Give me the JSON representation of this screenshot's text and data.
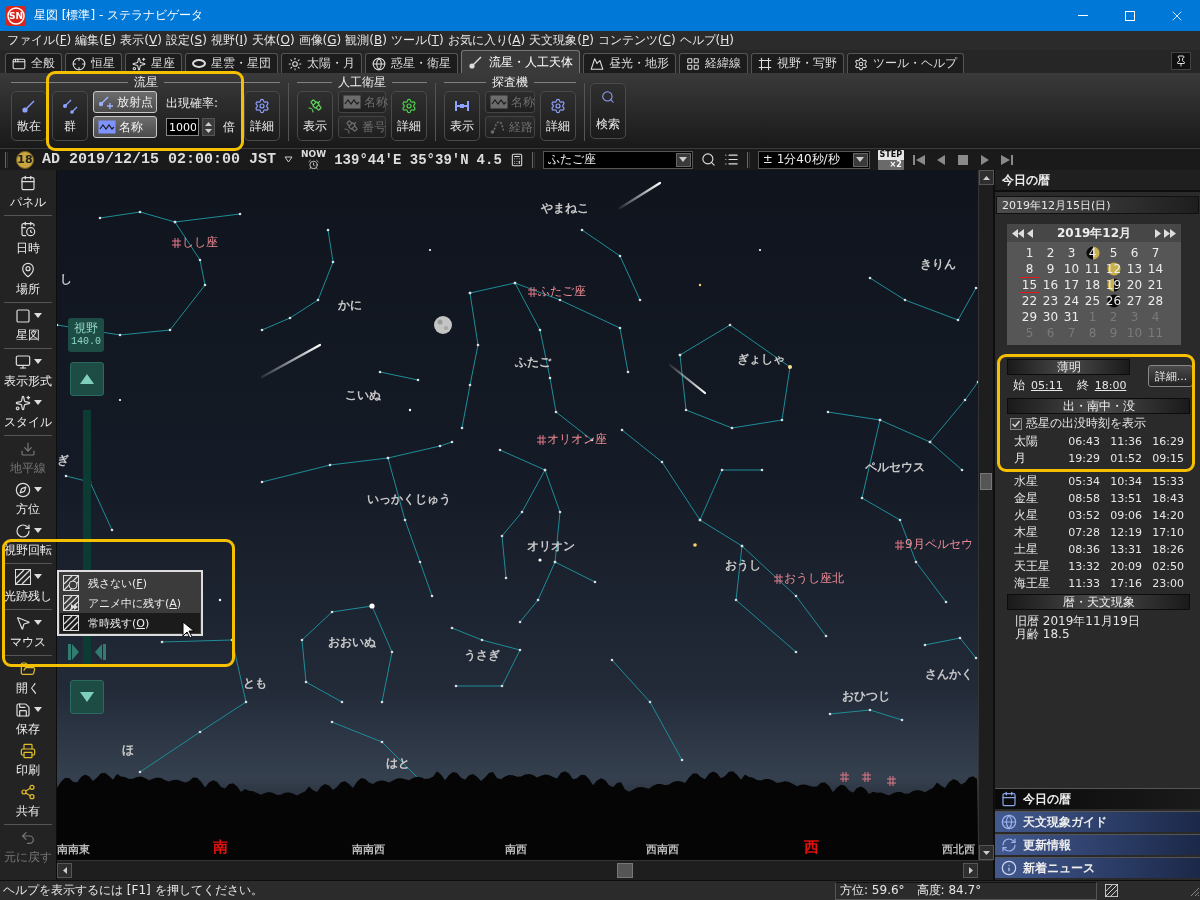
{
  "window": {
    "title": "星図 [標準] - ステラナビゲータ",
    "logo_text": "SN"
  },
  "menu": [
    "ファイル(F)",
    "編集(E)",
    "表示(V)",
    "設定(S)",
    "視野(I)",
    "天体(O)",
    "画像(G)",
    "観測(B)",
    "ツール(T)",
    "お気に入り(A)",
    "天文現象(P)",
    "コンテンツ(C)",
    "ヘルプ(H)"
  ],
  "tabs": [
    {
      "label": "全般",
      "selected": false
    },
    {
      "label": "恒星",
      "selected": false
    },
    {
      "label": "星座",
      "selected": false
    },
    {
      "label": "星雲・星団",
      "selected": false
    },
    {
      "label": "太陽・月",
      "selected": false
    },
    {
      "label": "惑星・衛星",
      "selected": false
    },
    {
      "label": "流星・人工天体",
      "selected": true
    },
    {
      "label": "昼光・地形",
      "selected": false
    },
    {
      "label": "経緯線",
      "selected": false
    },
    {
      "label": "視野・写野",
      "selected": false
    },
    {
      "label": "ツール・ヘルプ",
      "selected": false
    }
  ],
  "ribbon": {
    "groups": [
      {
        "title": "流星",
        "items": [
          {
            "kind": "large",
            "label": "散在",
            "disabled": false
          },
          {
            "kind": "large",
            "label": "群",
            "disabled": false
          },
          {
            "kind": "stack",
            "buttons": [
              {
                "label": "放射点",
                "checked": true,
                "disabled": false
              },
              {
                "label": "名称",
                "checked": true,
                "disabled": false
              }
            ]
          },
          {
            "kind": "spinner",
            "label": "出現確率:",
            "value": "1000",
            "unit": "倍"
          },
          {
            "kind": "large",
            "label": "詳細",
            "disabled": false
          }
        ]
      },
      {
        "title": "人工衛星",
        "items": [
          {
            "kind": "large",
            "label": "表示",
            "disabled": false
          },
          {
            "kind": "stack",
            "buttons": [
              {
                "label": "名称",
                "checked": false,
                "disabled": true
              },
              {
                "label": "番号",
                "checked": false,
                "disabled": true
              }
            ]
          },
          {
            "kind": "large",
            "label": "詳細",
            "disabled": false
          }
        ]
      },
      {
        "title": "探査機",
        "items": [
          {
            "kind": "large",
            "label": "表示",
            "disabled": false
          },
          {
            "kind": "stack",
            "buttons": [
              {
                "label": "名称",
                "checked": false,
                "disabled": true
              },
              {
                "label": "経路",
                "checked": false,
                "disabled": true
              }
            ]
          },
          {
            "kind": "large",
            "label": "詳細",
            "disabled": false
          }
        ]
      }
    ],
    "search": {
      "label": "検索"
    }
  },
  "info_bar": {
    "badge": "18",
    "datetime": "AD 2019/12/15 02:00:00 JST",
    "now_label": "NOW",
    "location": "139°44'E 35°39'N",
    "magnitude": "4.5",
    "target": "ふたご座",
    "speed": "± 1分40秒/秒",
    "step_label": "STEP",
    "step_factor": "×2"
  },
  "sidebar": {
    "groups": [
      {
        "items": [
          {
            "label": "パネル",
            "menu": false,
            "disabled": false
          }
        ]
      },
      {
        "items": [
          {
            "label": "日時",
            "menu": false,
            "disabled": false
          },
          {
            "label": "場所",
            "menu": false,
            "disabled": false
          }
        ]
      },
      {
        "items": [
          {
            "label": "星図",
            "menu": true,
            "disabled": false
          }
        ]
      },
      {
        "items": [
          {
            "label": "表示形式",
            "menu": true,
            "disabled": false
          },
          {
            "label": "スタイル",
            "menu": true,
            "disabled": false
          }
        ]
      },
      {
        "items": [
          {
            "label": "地平線",
            "menu": false,
            "disabled": true
          },
          {
            "label": "方位",
            "menu": true,
            "disabled": false
          },
          {
            "label": "視野回転",
            "menu": true,
            "disabled": false
          }
        ]
      },
      {
        "items": [
          {
            "label": "光跡残し",
            "menu": true,
            "disabled": false
          }
        ]
      },
      {
        "items": [
          {
            "label": "マウス",
            "menu": true,
            "disabled": false
          }
        ]
      },
      {
        "items": [
          {
            "label": "開く",
            "menu": false,
            "disabled": false
          },
          {
            "label": "保存",
            "menu": true,
            "disabled": false
          },
          {
            "label": "印刷",
            "menu": false,
            "disabled": false
          },
          {
            "label": "共有",
            "menu": false,
            "disabled": false
          }
        ]
      },
      {
        "items": [
          {
            "label": "元に戻す",
            "menu": false,
            "disabled": true
          }
        ]
      }
    ]
  },
  "fov": {
    "label": "視野",
    "value": "140.0",
    "level": 0.02
  },
  "trail_menu": {
    "items": [
      {
        "label": "残さない(F)",
        "selected": false
      },
      {
        "label": "アニメ中に残す(A)",
        "selected": false
      },
      {
        "label": "常時残す(O)",
        "selected": true
      }
    ]
  },
  "sky": {
    "constellations": [
      "やまねこ",
      "きりん",
      "かに",
      "ふたご",
      "ぎょしゃ",
      "こいぬ",
      "いっかくじゅう",
      "オリオン",
      "ペルセウス",
      "おうし",
      "おおいぬ",
      "うさぎ",
      "とも",
      "おひつじ",
      "さんかく",
      "ほ",
      "はと",
      "し",
      "ぎ"
    ],
    "radiants": [
      "しし座",
      "ふたご座",
      "オリオン座",
      "おうし座北",
      "9月ペルセウ"
    ],
    "compass": [
      {
        "label": "南南東",
        "kind": "minor"
      },
      {
        "label": "南",
        "kind": "cardinal"
      },
      {
        "label": "南南西",
        "kind": "minor"
      },
      {
        "label": "南西",
        "kind": "minor"
      },
      {
        "label": "西南西",
        "kind": "minor"
      },
      {
        "label": "西",
        "kind": "cardinal"
      },
      {
        "label": "西北西",
        "kind": "minor"
      }
    ]
  },
  "almanac": {
    "title": "今日の暦",
    "date": "2019年12月15日(日)",
    "calendar": {
      "month": "2019年12月",
      "days": [
        {
          "day": "1",
          "kind": "plain",
          "dimmed": false,
          "selected": false
        },
        {
          "day": "2",
          "kind": "plain",
          "dimmed": false,
          "selected": false
        },
        {
          "day": "3",
          "kind": "plain",
          "dimmed": false,
          "selected": false
        },
        {
          "day": "4",
          "kind": "firstquarter",
          "dimmed": false,
          "selected": false
        },
        {
          "day": "5",
          "kind": "plain",
          "dimmed": false,
          "selected": false
        },
        {
          "day": "6",
          "kind": "plain",
          "dimmed": false,
          "selected": false
        },
        {
          "day": "7",
          "kind": "plain",
          "dimmed": false,
          "selected": false
        },
        {
          "day": "8",
          "kind": "plain",
          "dimmed": false,
          "selected": false
        },
        {
          "day": "9",
          "kind": "plain",
          "dimmed": false,
          "selected": false
        },
        {
          "day": "10",
          "kind": "plain",
          "dimmed": false,
          "selected": false
        },
        {
          "day": "11",
          "kind": "plain",
          "dimmed": false,
          "selected": false
        },
        {
          "day": "12",
          "kind": "full",
          "dimmed": false,
          "selected": false
        },
        {
          "day": "13",
          "kind": "plain",
          "dimmed": false,
          "selected": false
        },
        {
          "day": "14",
          "kind": "plain",
          "dimmed": false,
          "selected": false
        },
        {
          "day": "15",
          "kind": "plain",
          "dimmed": false,
          "selected": true
        },
        {
          "day": "16",
          "kind": "plain",
          "dimmed": false,
          "selected": false
        },
        {
          "day": "17",
          "kind": "plain",
          "dimmed": false,
          "selected": false
        },
        {
          "day": "18",
          "kind": "plain",
          "dimmed": false,
          "selected": false
        },
        {
          "day": "19",
          "kind": "lastquarter",
          "dimmed": false,
          "selected": false
        },
        {
          "day": "20",
          "kind": "plain",
          "dimmed": false,
          "selected": false
        },
        {
          "day": "21",
          "kind": "plain",
          "dimmed": false,
          "selected": false
        },
        {
          "day": "22",
          "kind": "plain",
          "dimmed": false,
          "selected": false
        },
        {
          "day": "23",
          "kind": "plain",
          "dimmed": false,
          "selected": false
        },
        {
          "day": "24",
          "kind": "plain",
          "dimmed": false,
          "selected": false
        },
        {
          "day": "25",
          "kind": "plain",
          "dimmed": false,
          "selected": false
        },
        {
          "day": "26",
          "kind": "new",
          "dimmed": false,
          "selected": false
        },
        {
          "day": "27",
          "kind": "plain",
          "dimmed": false,
          "selected": false
        },
        {
          "day": "28",
          "kind": "plain",
          "dimmed": false,
          "selected": false
        },
        {
          "day": "29",
          "kind": "plain",
          "dimmed": false,
          "selected": false
        },
        {
          "day": "30",
          "kind": "plain",
          "dimmed": false,
          "selected": false
        },
        {
          "day": "31",
          "kind": "plain",
          "dimmed": false,
          "selected": false
        },
        {
          "day": "1",
          "kind": "plain",
          "dimmed": true,
          "selected": false
        },
        {
          "day": "2",
          "kind": "plain",
          "dimmed": true,
          "selected": false
        },
        {
          "day": "3",
          "kind": "plain",
          "dimmed": true,
          "selected": false
        },
        {
          "day": "4",
          "kind": "plain",
          "dimmed": true,
          "selected": false
        },
        {
          "day": "5",
          "kind": "plain",
          "dimmed": true,
          "selected": false
        },
        {
          "day": "6",
          "kind": "plain",
          "dimmed": true,
          "selected": false
        },
        {
          "day": "7",
          "kind": "plain",
          "dimmed": true,
          "selected": false
        },
        {
          "day": "8",
          "kind": "plain",
          "dimmed": true,
          "selected": false
        },
        {
          "day": "9",
          "kind": "plain",
          "dimmed": true,
          "selected": false
        },
        {
          "day": "10",
          "kind": "plain",
          "dimmed": true,
          "selected": false
        },
        {
          "day": "11",
          "kind": "plain",
          "dimmed": true,
          "selected": false
        }
      ]
    },
    "twilight": {
      "title": "薄明",
      "start_label": "始",
      "start": "05:11",
      "end_label": "終",
      "end": "18:00",
      "details_button": "詳細..."
    },
    "rise_set": {
      "title": "出・南中・没",
      "show_planets": {
        "label": "惑星の出没時刻を表示",
        "checked": true
      },
      "rows": [
        {
          "body": "太陽",
          "rise": "06:43",
          "transit": "11:36",
          "set": "16:29"
        },
        {
          "body": "月",
          "rise": "19:29",
          "transit": "01:52",
          "set": "09:15"
        },
        {
          "body": "水星",
          "rise": "05:34",
          "transit": "10:34",
          "set": "15:33"
        },
        {
          "body": "金星",
          "rise": "08:58",
          "transit": "13:51",
          "set": "18:43"
        },
        {
          "body": "火星",
          "rise": "03:52",
          "transit": "09:06",
          "set": "14:20"
        },
        {
          "body": "木星",
          "rise": "07:28",
          "transit": "12:19",
          "set": "17:10"
        },
        {
          "body": "土星",
          "rise": "08:36",
          "transit": "13:31",
          "set": "18:26"
        },
        {
          "body": "天王星",
          "rise": "13:32",
          "transit": "20:09",
          "set": "02:50"
        },
        {
          "body": "海王星",
          "rise": "11:33",
          "transit": "17:16",
          "set": "23:00"
        }
      ]
    },
    "events": {
      "title": "暦・天文現象",
      "lines": [
        "旧暦 2019年11月19日",
        "月齢 18.5"
      ]
    }
  },
  "panel_nav": [
    {
      "label": "今日の暦",
      "selected": true
    },
    {
      "label": "天文現象ガイド",
      "selected": false
    },
    {
      "label": "更新情報",
      "selected": false
    },
    {
      "label": "新着ニュース",
      "selected": false
    }
  ],
  "status_bar": {
    "help": "ヘルプを表示するには [F1] を押してください。",
    "azimuth": "方位:  59.6°",
    "altitude": "高度:  84.7°"
  }
}
